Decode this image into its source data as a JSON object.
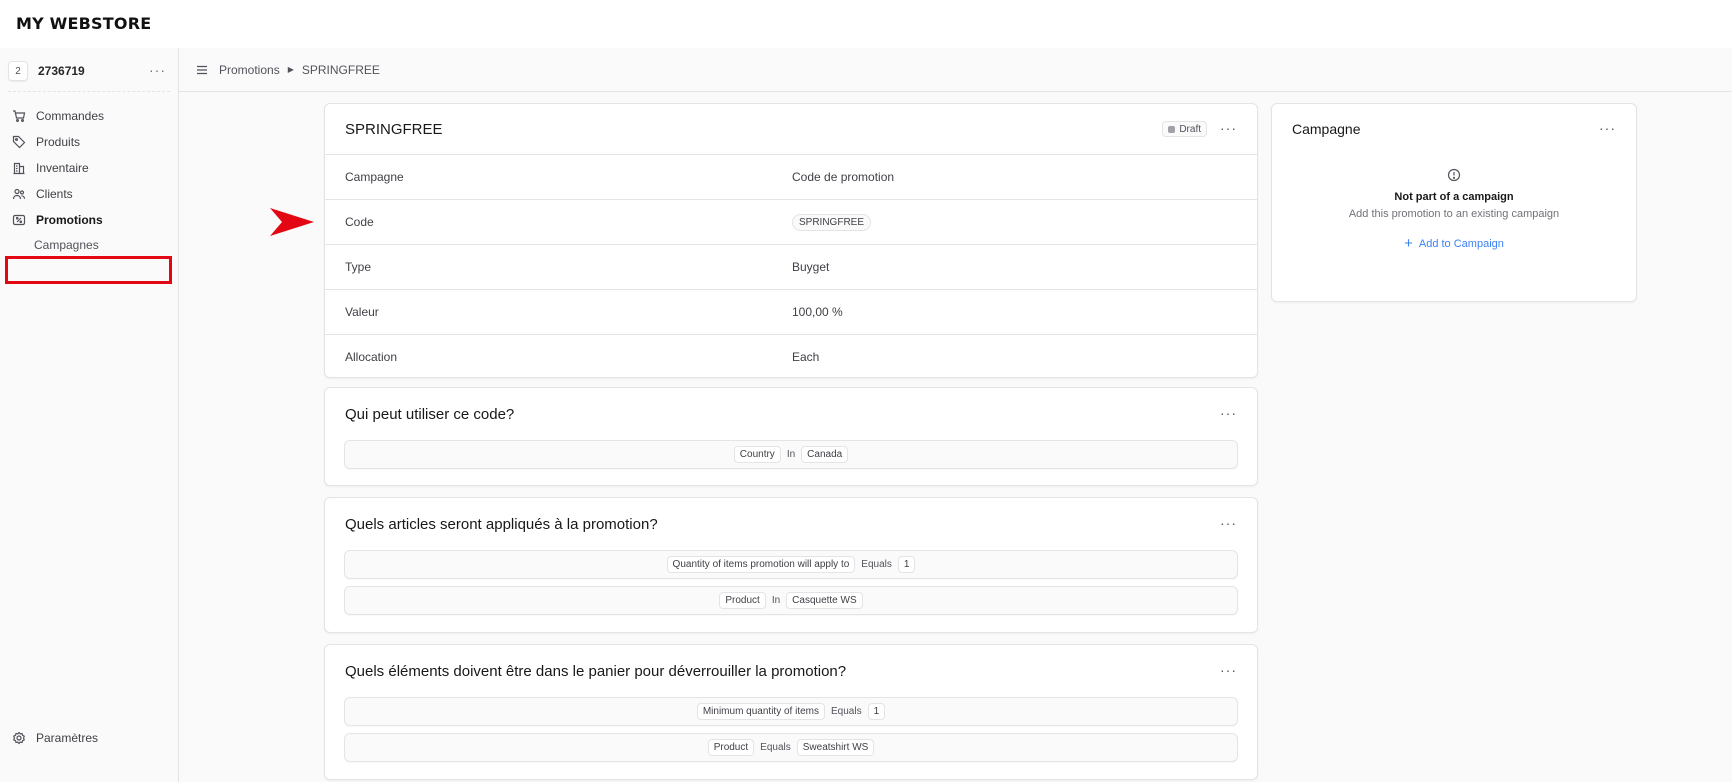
{
  "brand": "MY WEBSTORE",
  "store": {
    "badge": "2",
    "name": "2736719",
    "menu": "···"
  },
  "nav": [
    {
      "label": "Commandes",
      "icon": "cart-icon"
    },
    {
      "label": "Produits",
      "icon": "tag-icon"
    },
    {
      "label": "Inventaire",
      "icon": "building-icon"
    },
    {
      "label": "Clients",
      "icon": "users-icon"
    },
    {
      "label": "Promotions",
      "icon": "receipt-percent-icon"
    }
  ],
  "nav_sub": {
    "label": "Campagnes"
  },
  "settings": {
    "label": "Paramètres"
  },
  "breadcrumb": {
    "parent": "Promotions",
    "current": "SPRINGFREE"
  },
  "promo": {
    "title": "SPRINGFREE",
    "status": "Draft",
    "rows": [
      {
        "key": "Campagne",
        "value": "Code de promotion"
      },
      {
        "key": "Code",
        "value": "SPRINGFREE"
      },
      {
        "key": "Type",
        "value": "Buyget"
      },
      {
        "key": "Valeur",
        "value": "100,00 %"
      },
      {
        "key": "Allocation",
        "value": "Each"
      }
    ]
  },
  "sections": [
    {
      "title": "Qui peut utiliser ce code?",
      "rules": [
        {
          "attr": "Country",
          "op": "In",
          "value": "Canada"
        }
      ]
    },
    {
      "title": "Quels articles seront appliqués à la promotion?",
      "rules": [
        {
          "attr": "Quantity of items promotion will apply to",
          "op": "Equals",
          "value": "1"
        },
        {
          "attr": "Product",
          "op": "In",
          "value": "Casquette WS"
        }
      ]
    },
    {
      "title": "Quels éléments doivent être dans le panier pour déverrouiller la promotion?",
      "rules": [
        {
          "attr": "Minimum quantity of items",
          "op": "Equals",
          "value": "1"
        },
        {
          "attr": "Product",
          "op": "Equals",
          "value": "Sweatshirt WS"
        }
      ]
    }
  ],
  "campaign": {
    "title": "Campagne",
    "empty_title": "Not part of a campaign",
    "empty_desc": "Add this promotion to an existing campaign",
    "add_label": "Add to Campaign"
  },
  "colors": {
    "highlight": "#e30613",
    "link": "#3b82f6"
  }
}
